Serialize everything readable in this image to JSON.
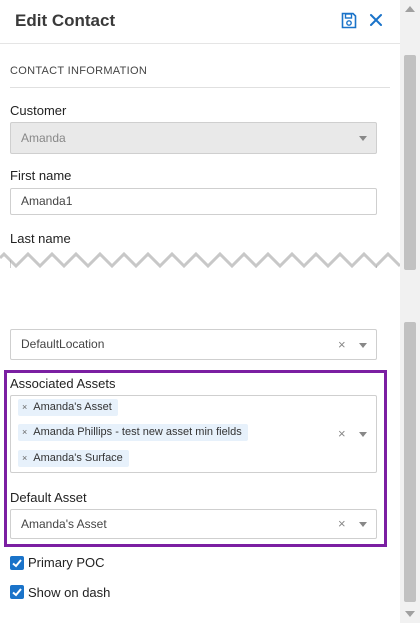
{
  "header": {
    "title": "Edit Contact",
    "save_icon": "save-icon",
    "close_icon": "close-icon",
    "accent_color": "#1a73c9"
  },
  "section": {
    "title": "CONTACT INFORMATION"
  },
  "customer": {
    "label": "Customer",
    "value": "Amanda"
  },
  "first_name": {
    "label": "First name",
    "value": "Amanda1"
  },
  "last_name": {
    "label": "Last name"
  },
  "location": {
    "value": "DefaultLocation"
  },
  "associated_assets": {
    "label": "Associated Assets",
    "tags": [
      "Amanda's Asset",
      "Amanda Phillips - test new asset min fields",
      "Amanda's Surface"
    ]
  },
  "default_asset": {
    "label": "Default Asset",
    "value": "Amanda's Asset"
  },
  "checkboxes": [
    {
      "label": "Primary POC",
      "checked": true
    },
    {
      "label": "Show on dash",
      "checked": true
    }
  ],
  "highlight_color": "#7b1fa2"
}
